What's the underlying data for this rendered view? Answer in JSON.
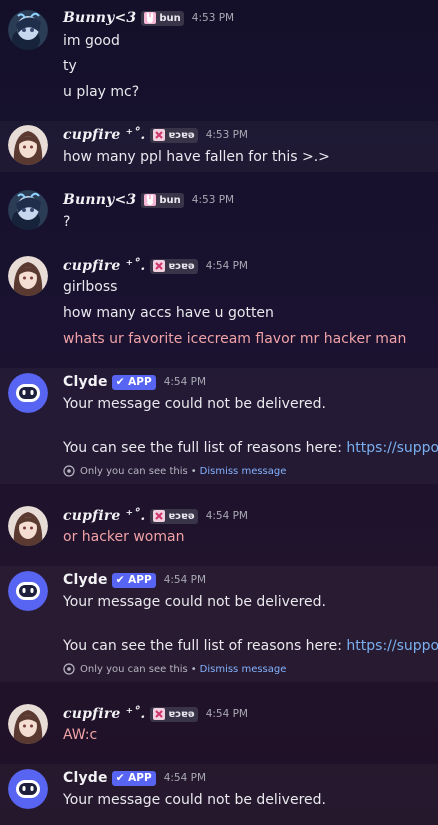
{
  "users": {
    "bunny": {
      "name": "Bunny<3",
      "tag": "bun"
    },
    "cupfire": {
      "name": "cupfire ⁺˚.",
      "tag": "ɐɔɐǝ"
    },
    "clyde": {
      "name": "Clyde",
      "badge": "✔ APP"
    }
  },
  "messages": [
    {
      "author": "Bunny<3",
      "time": "4:53 PM",
      "lines": [
        "im good",
        "ty",
        "u play mc?"
      ]
    },
    {
      "author": "cupfire",
      "time": "4:53 PM",
      "lines": [
        "how many ppl have fallen for this >.>"
      ]
    },
    {
      "author": "Bunny<3",
      "time": "4:53 PM",
      "lines": [
        "?"
      ]
    },
    {
      "author": "cupfire",
      "time": "4:54 PM",
      "lines": [
        "girlboss",
        "how many accs have u gotten",
        "whats ur favorite icecream flavor mr hacker man"
      ]
    },
    {
      "author": "Clyde",
      "time": "4:54 PM",
      "lines": [
        "Your message could not be delivered.",
        "You can see the full list of reasons here: ",
        "https://support"
      ],
      "ephemeral": "Only you can see this",
      "dismiss": "Dismiss message"
    },
    {
      "author": "cupfire",
      "time": "4:54 PM",
      "lines": [
        "or hacker woman"
      ]
    },
    {
      "author": "Clyde",
      "time": "4:54 PM",
      "lines": [
        "Your message could not be delivered.",
        "You can see the full list of reasons here: ",
        "https://support"
      ],
      "ephemeral": "Only you can see this",
      "dismiss": "Dismiss message"
    },
    {
      "author": "cupfire",
      "time": "4:54 PM",
      "lines": [
        "AW:c"
      ]
    },
    {
      "author": "Clyde",
      "time": "4:54 PM",
      "lines": [
        "Your message could not be delivered."
      ]
    }
  ],
  "ui": {
    "dismiss_separator": "•"
  }
}
